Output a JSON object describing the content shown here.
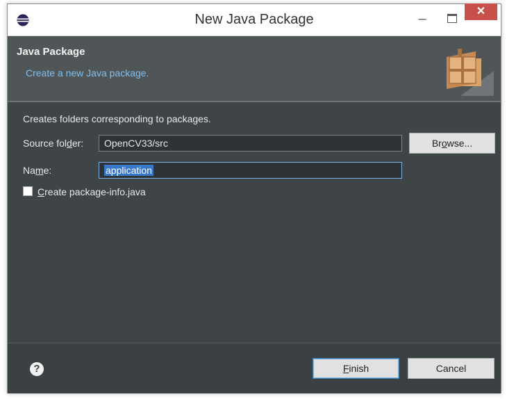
{
  "titlebar": {
    "title": "New Java Package",
    "app_icon": "eclipse-icon",
    "minimize_glyph": "–",
    "close_glyph": "✕"
  },
  "header": {
    "title": "Java Package",
    "description": "Create a new Java package."
  },
  "form": {
    "intro": "Creates folders corresponding to packages.",
    "source_folder": {
      "label_pre": "Source fol",
      "label_mnemonic": "d",
      "label_post": "er:",
      "value": "OpenCV33/src"
    },
    "browse": {
      "pre": "Br",
      "mnemonic": "o",
      "post": "wse..."
    },
    "name": {
      "label_pre": "Na",
      "label_mnemonic": "m",
      "label_post": "e:",
      "value": "application"
    },
    "package_info": {
      "mnemonic": "C",
      "label_post": "reate package-info.java",
      "checked": false
    }
  },
  "footer": {
    "help_glyph": "?",
    "finish": {
      "mnemonic": "F",
      "post": "inish"
    },
    "cancel": "Cancel"
  },
  "colors": {
    "window_bg": "#3f4447",
    "header_bg": "#505658",
    "link_blue": "#82bff0",
    "close_red": "#c7504a",
    "selection": "#3878c8"
  }
}
